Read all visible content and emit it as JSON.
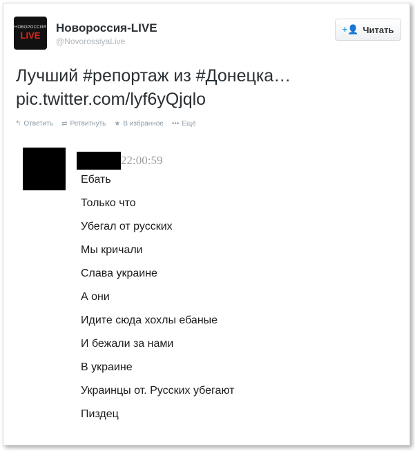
{
  "tweet": {
    "avatar_text_top": "НОВОРОССИЯ",
    "avatar_text_bottom": "LIVE",
    "author_name": "Новороссия-LIVE",
    "author_handle": "@NovorossiyaLive",
    "follow_button": "Читать",
    "text_line1": "Лучший #репортаж из #Донецка…",
    "text_line2": "pic.twitter.com/lyf6yQjqlo",
    "actions": {
      "reply": "Ответить",
      "retweet": "Ретвитнуть",
      "favorite": "В избранное",
      "more": "Ещё"
    }
  },
  "embedded_chat": {
    "timestamp": "22:00:59",
    "messages": [
      "Ебать",
      "Только что",
      "Убегал от русских",
      "Мы кричали",
      "Слава украине",
      "А они",
      "Идите сюда хохлы ебаные",
      "И бежали за нами",
      "В украине",
      "Украинцы от. Русских убегают",
      "Пиздец"
    ]
  },
  "colors": {
    "text": "#292f33",
    "muted": "#8899a6",
    "follow_icon": "#2a9fd6",
    "avatar_accent": "#e0261a"
  }
}
